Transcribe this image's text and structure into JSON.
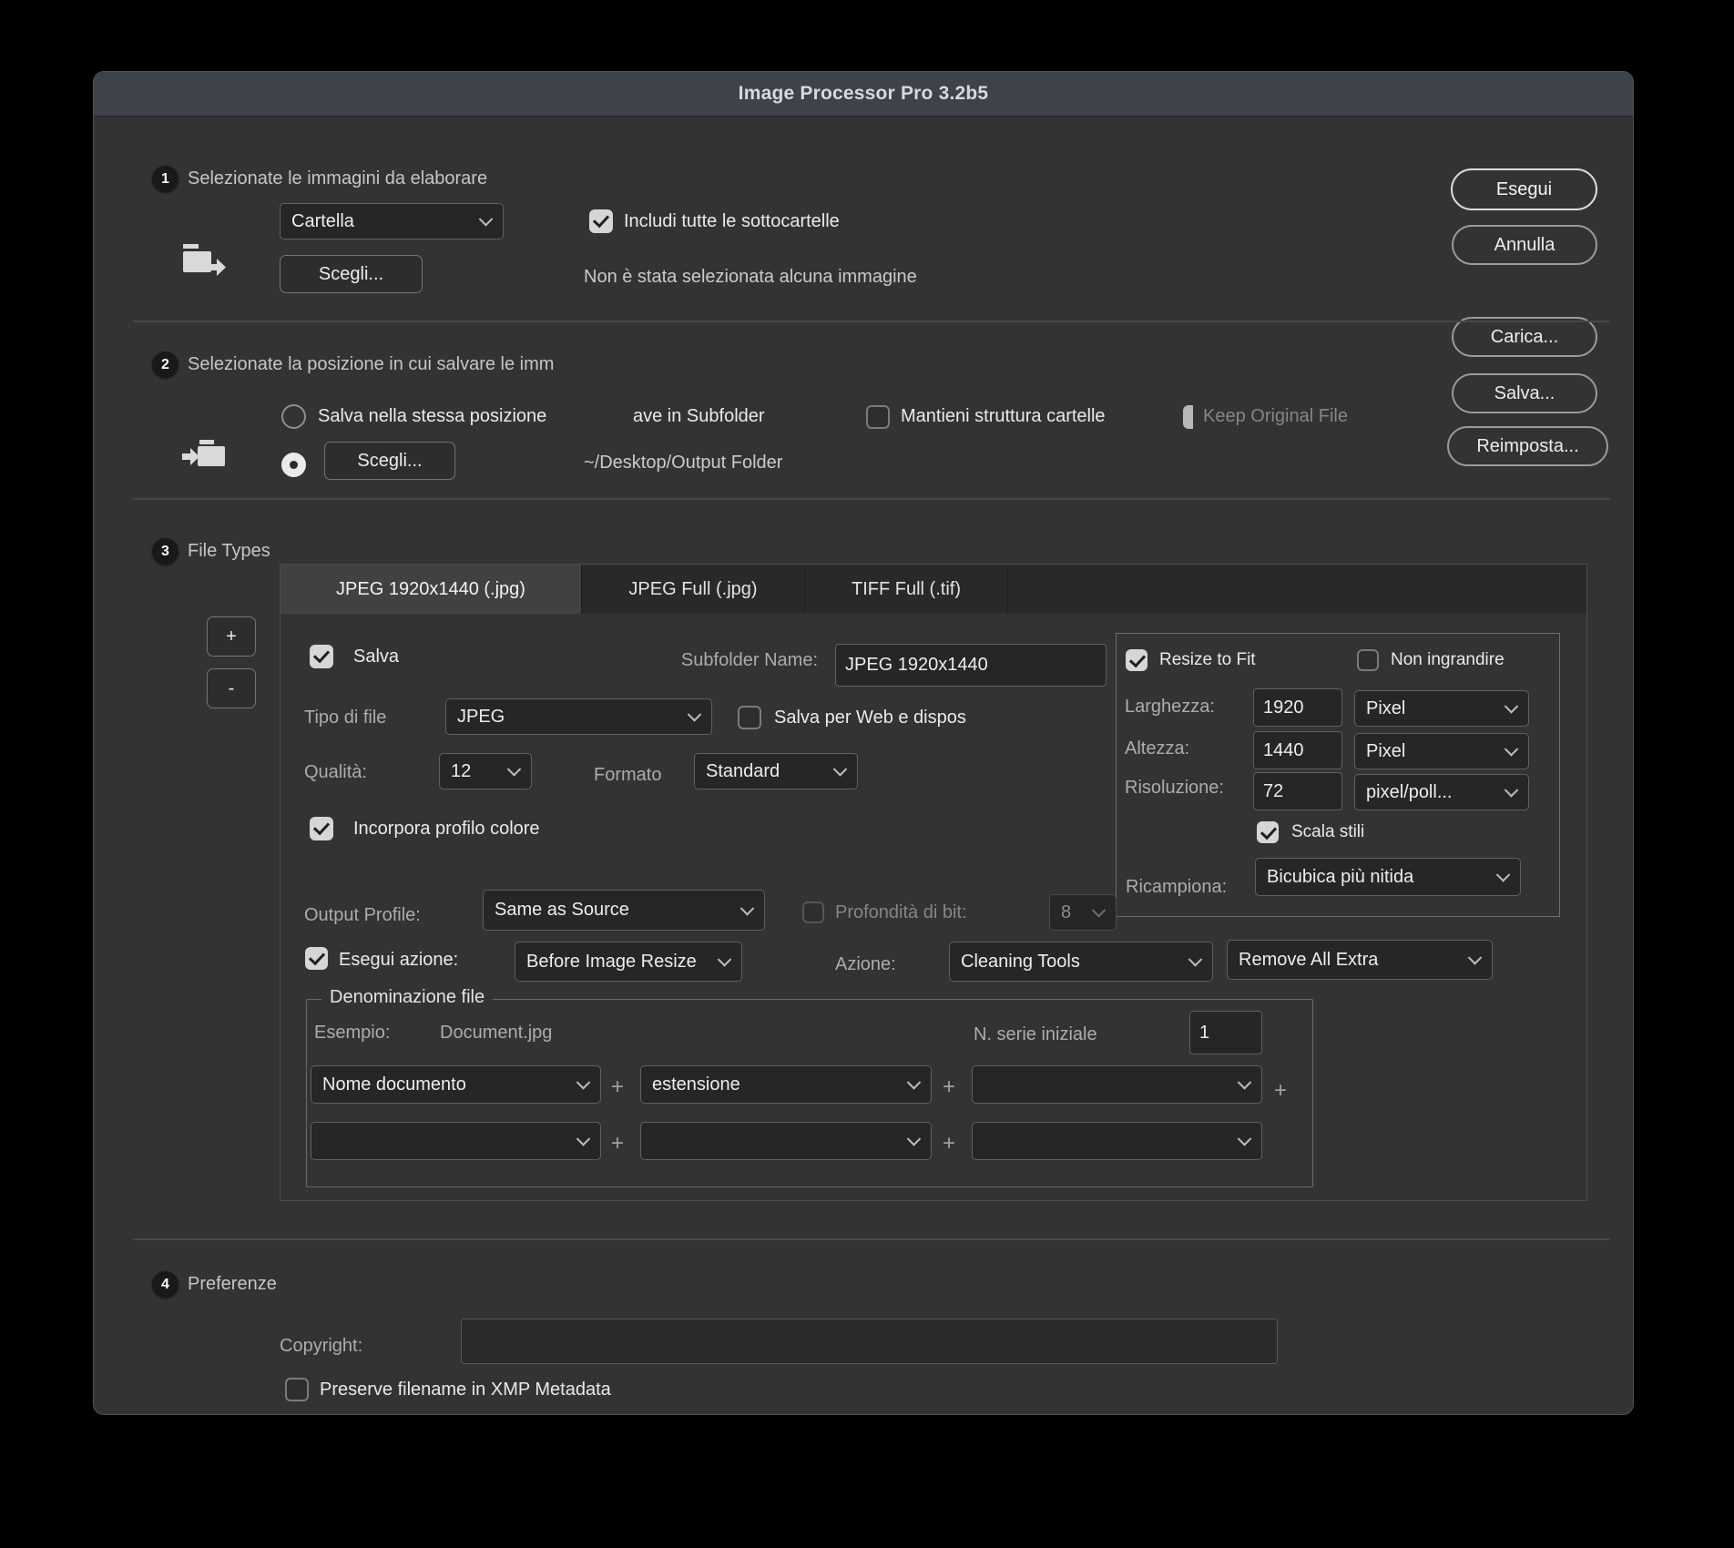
{
  "window": {
    "title": "Image Processor Pro 3.2b5"
  },
  "actions": {
    "esegui": "Esegui",
    "annulla": "Annulla",
    "carica": "Carica...",
    "salva": "Salva...",
    "reimposta": "Reimposta..."
  },
  "section1": {
    "number": "1",
    "title": "Selezionate le immagini da elaborare",
    "source_select_value": "Cartella",
    "include_subfolders_label": "Includi tutte le sottocartelle",
    "choose_button": "Scegli...",
    "status": "Non è stata selezionata alcuna immagine"
  },
  "section2": {
    "number": "2",
    "title": "Selezionate la posizione in cui salvare le imm",
    "radio_same_position_label": "Salva nella stessa posizione",
    "overlap_text": "ave in Subfolder",
    "keep_structure_label": "Mantieni struttura cartelle",
    "keep_original_label": "Keep Original File",
    "choose_button": "Scegli...",
    "output_path": "~/Desktop/Output Folder"
  },
  "section3": {
    "number": "3",
    "title": "File Types",
    "tabs": [
      {
        "label": "JPEG 1920x1440 (.jpg)"
      },
      {
        "label": "JPEG Full (.jpg)"
      },
      {
        "label": "TIFF Full (.tif)"
      }
    ],
    "add_button": "+",
    "remove_button": "-",
    "save_label": "Salva",
    "subfolder_name_label": "Subfolder Name:",
    "subfolder_name_value": "JPEG 1920x1440",
    "file_type_label": "Tipo di file",
    "file_type_value": "JPEG",
    "save_for_web_label": "Salva per Web e dispos",
    "quality_label": "Qualità:",
    "quality_value": "12",
    "format_label": "Formato",
    "format_value": "Standard",
    "embed_profile_label": "Incorpora profilo colore",
    "resize": {
      "resize_to_fit_label": "Resize to Fit",
      "no_enlarge_label": "Non ingrandire",
      "width_label": "Larghezza:",
      "width_value": "1920",
      "width_unit": "Pixel",
      "height_label": "Altezza:",
      "height_value": "1440",
      "height_unit": "Pixel",
      "resolution_label": "Risoluzione:",
      "resolution_value": "72",
      "resolution_unit": "pixel/poll...",
      "scale_styles_label": "Scala stili",
      "resample_label": "Ricampiona:",
      "resample_value": "Bicubica più nitida"
    },
    "output_profile_label": "Output Profile:",
    "output_profile_value": "Same as Source",
    "bit_depth_label": "Profondità di bit:",
    "bit_depth_value": "8",
    "run_action_label": "Esegui azione:",
    "run_action_value": "Before Image Resize",
    "action_label": "Azione:",
    "action_set_value": "Cleaning Tools",
    "action_name_value": "Remove All Extra",
    "naming": {
      "group_title": "Denominazione file",
      "example_label": "Esempio:",
      "example_value": "Document.jpg",
      "serial_label": "N. serie iniziale",
      "serial_value": "1",
      "plus": "+",
      "row1": [
        "Nome documento",
        "estensione",
        ""
      ],
      "row2": [
        "",
        "",
        ""
      ]
    }
  },
  "section4": {
    "number": "4",
    "title": "Preferenze",
    "copyright_label": "Copyright:",
    "copyright_value": "",
    "preserve_label": "Preserve filename in XMP Metadata"
  },
  "colors": {
    "titlebar": "#3e424b",
    "dialog_bg": "#333333",
    "control_bg": "#262626",
    "checkbox_on": "#d6d6d6",
    "text_white": "#e9eaec",
    "text_grey": "#abacae",
    "text_disabled": "#85868a"
  }
}
